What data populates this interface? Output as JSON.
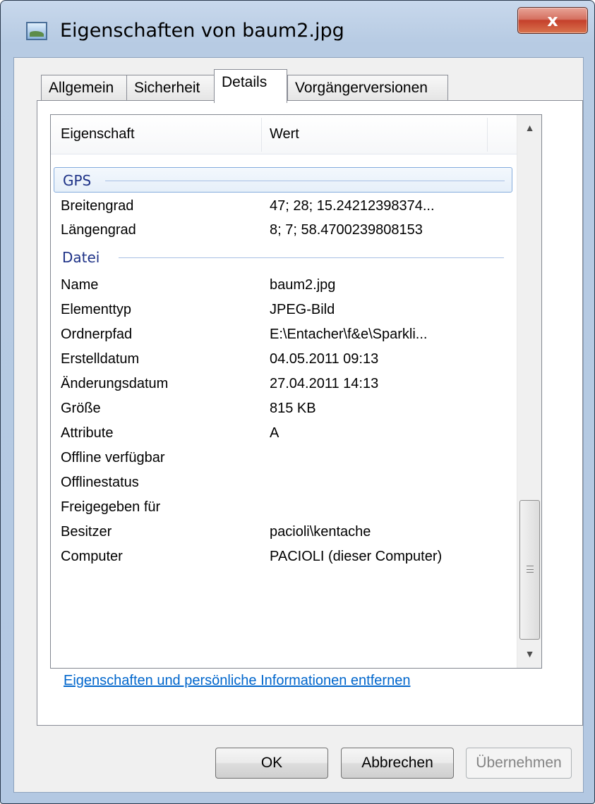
{
  "window": {
    "title": "Eigenschaften von baum2.jpg",
    "close_label": "x"
  },
  "tabs": [
    {
      "label": "Allgemein",
      "active": false
    },
    {
      "label": "Sicherheit",
      "active": false
    },
    {
      "label": "Details",
      "active": true
    },
    {
      "label": "Vorgängerversionen",
      "active": false
    }
  ],
  "columns": {
    "property": "Eigenschaft",
    "value": "Wert"
  },
  "groups": {
    "gps": {
      "label": "GPS",
      "rows": [
        {
          "property": "Breitengrad",
          "value": "47; 28; 15.24212398374..."
        },
        {
          "property": "Längengrad",
          "value": "8; 7; 58.4700239808153"
        }
      ]
    },
    "datei": {
      "label": "Datei",
      "rows": [
        {
          "property": "Name",
          "value": "baum2.jpg"
        },
        {
          "property": "Elementtyp",
          "value": "JPEG-Bild"
        },
        {
          "property": "Ordnerpfad",
          "value": "E:\\Entacher\\f&e\\Sparkli..."
        },
        {
          "property": "Erstelldatum",
          "value": "04.05.2011 09:13"
        },
        {
          "property": "Änderungsdatum",
          "value": "27.04.2011 14:13"
        },
        {
          "property": "Größe",
          "value": "815 KB"
        },
        {
          "property": "Attribute",
          "value": "A"
        },
        {
          "property": "Offline verfügbar",
          "value": ""
        },
        {
          "property": "Offlinestatus",
          "value": ""
        },
        {
          "property": "Freigegeben für",
          "value": ""
        },
        {
          "property": "Besitzer",
          "value": "pacioli\\kentache"
        },
        {
          "property": "Computer",
          "value": "PACIOLI (dieser Computer)"
        }
      ]
    }
  },
  "remove_link": "Eigenschaften und persönliche Informationen entfernen",
  "buttons": {
    "ok": "OK",
    "cancel": "Abbrechen",
    "apply": "Übernehmen"
  },
  "scrollbar": {
    "up_arrow": "▲",
    "down_arrow": "▼",
    "grip_icon": "grip-lines-icon"
  }
}
